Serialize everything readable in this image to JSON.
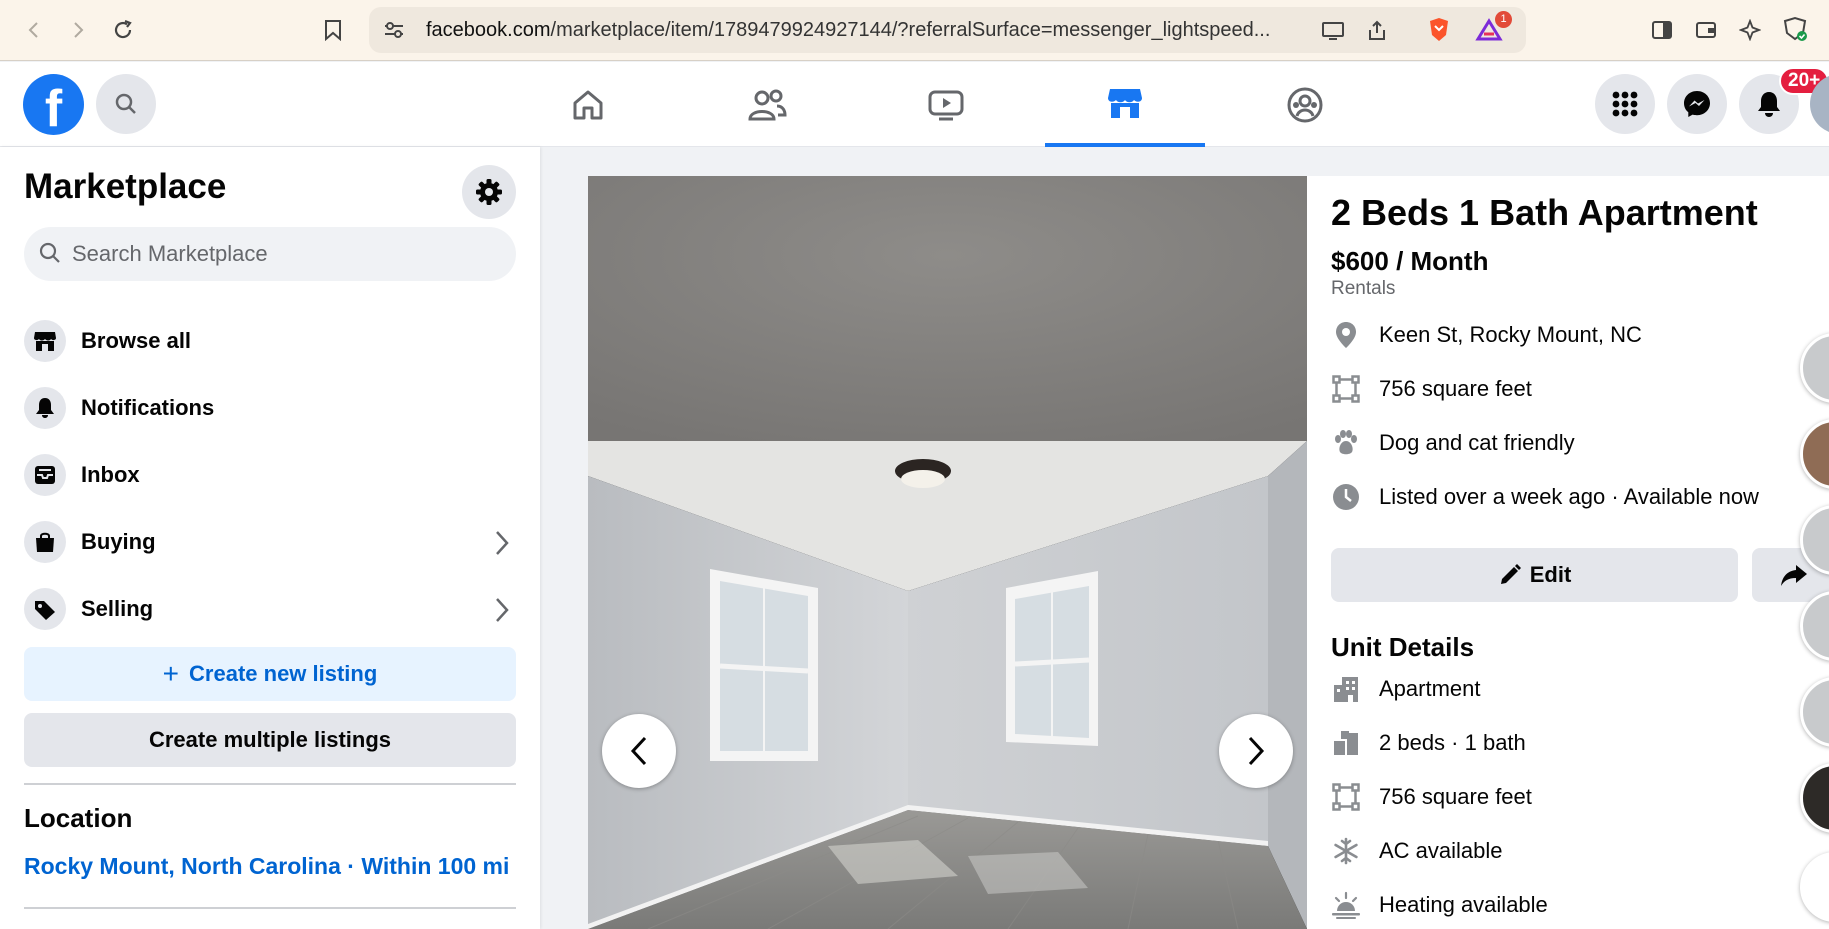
{
  "browser": {
    "url_domain": "facebook.com",
    "url_path": "/marketplace/item/1789479924927144/?referralSurface=messenger_lightspeed...",
    "extension_badge": "1"
  },
  "topbar": {
    "logo": "f",
    "notifications_badge": "20+",
    "nav_tabs": [
      "home-icon",
      "friends-icon",
      "watch-icon",
      "marketplace-icon",
      "groups-icon"
    ],
    "accent": "#1877f2"
  },
  "sidebar": {
    "title": "Marketplace",
    "search_placeholder": "Search Marketplace",
    "items": [
      {
        "label": "Browse all",
        "icon": "store-icon"
      },
      {
        "label": "Notifications",
        "icon": "bell-icon"
      },
      {
        "label": "Inbox",
        "icon": "inbox-icon"
      },
      {
        "label": "Buying",
        "icon": "bag-icon"
      },
      {
        "label": "Selling",
        "icon": "tag-icon"
      }
    ],
    "create_listing": "Create new listing",
    "create_multiple": "Create multiple listings",
    "location_heading": "Location",
    "location_value": "Rocky Mount, North Carolina · Within 100 mi"
  },
  "listing": {
    "title": "2 Beds 1 Bath Apartment",
    "price": "$600 / Month",
    "category": "Rentals",
    "facts": [
      {
        "icon": "location-pin-icon",
        "text": "Keen St, Rocky Mount, NC"
      },
      {
        "icon": "area-icon",
        "text": "756 square feet"
      },
      {
        "icon": "paw-icon",
        "text": "Dog and cat friendly"
      },
      {
        "icon": "clock-icon",
        "text": "Listed over a week ago · Available now"
      }
    ],
    "edit_label": "Edit",
    "unit_details_heading": "Unit Details",
    "unit_details": [
      {
        "icon": "building-icon",
        "text": "Apartment"
      },
      {
        "icon": "beds-icon",
        "text": "2 beds · 1 bath"
      },
      {
        "icon": "area-icon",
        "text": "756 square feet"
      },
      {
        "icon": "snowflake-icon",
        "text": "AC available"
      },
      {
        "icon": "heat-icon",
        "text": "Heating available"
      }
    ]
  }
}
